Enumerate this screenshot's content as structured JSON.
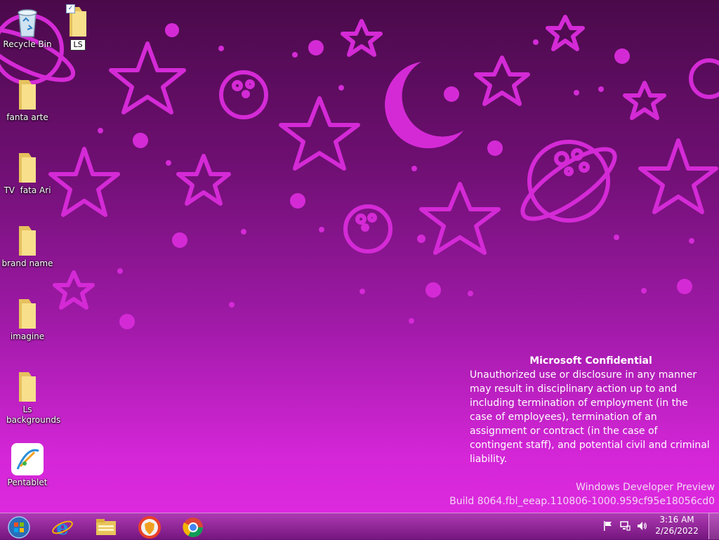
{
  "desktop": {
    "icons": [
      {
        "label": "Recycle Bin"
      },
      {
        "label": "LS"
      },
      {
        "label": "fanta arte"
      },
      {
        "label": "TV  fata Ari"
      },
      {
        "label": "brand name"
      },
      {
        "label": "imagine"
      },
      {
        "label": "Ls backgrounds"
      },
      {
        "label": "Pentablet"
      }
    ]
  },
  "notice": {
    "title": "Microsoft Confidential",
    "body": "Unauthorized use or disclosure in any manner may result in disciplinary action up to and including termination of employment (in the case of employees), termination of an assignment or contract (in the case of contingent staff), and potential civil and criminal liability."
  },
  "watermark": {
    "line1": "Windows Developer Preview",
    "line2": "Build 8064.fbl_eeap.110806-1000.959cf95e18056cd0"
  },
  "taskbar": {
    "apps": [
      "start-orb-icon",
      "internet-explorer-icon",
      "file-explorer-icon",
      "browser-shield-icon",
      "chrome-icon"
    ],
    "tray": [
      "flag-icon",
      "network-icon",
      "volume-icon"
    ],
    "time": "3:16 AM",
    "date": "2/26/2022"
  },
  "colors": {
    "wallpaper_shapes": "#d42ad6",
    "wallpaper_dark": "#4a0a4a",
    "wallpaper_light": "#e02be2"
  }
}
